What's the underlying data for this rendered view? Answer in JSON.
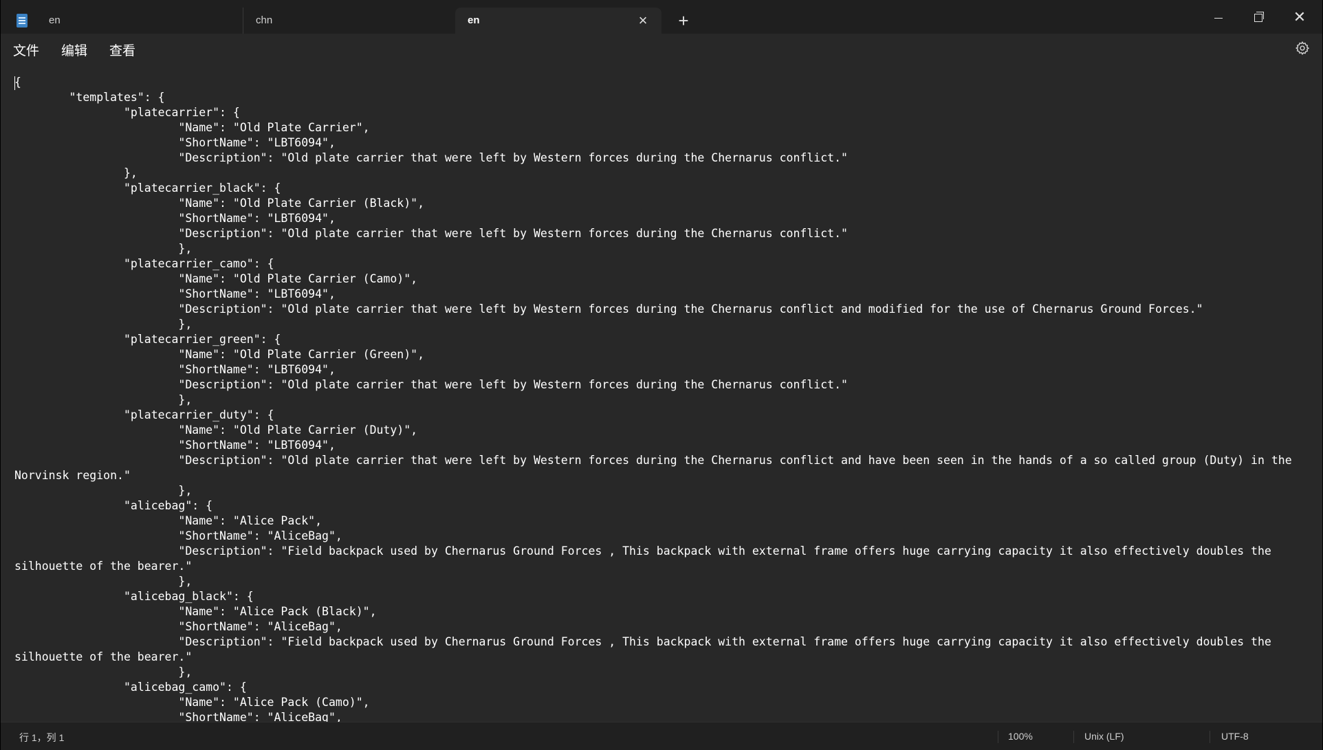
{
  "tabs": [
    {
      "label": "en",
      "active": false
    },
    {
      "label": "chn",
      "active": false
    },
    {
      "label": "en",
      "active": true
    }
  ],
  "icons": {
    "close_tab": "×",
    "new_tab": "+",
    "window_close": "✕"
  },
  "menu": {
    "file": "文件",
    "edit": "编辑",
    "view": "查看"
  },
  "editor": {
    "text": "{\n\t\"templates\": {\n\t\t\"platecarrier\": {\n\t\t\t\"Name\": \"Old Plate Carrier\",\n\t\t\t\"ShortName\": \"LBT6094\",\n\t\t\t\"Description\": \"Old plate carrier that were left by Western forces during the Chernarus conflict.\"\n\t\t},\n\t\t\"platecarrier_black\": {\n\t\t\t\"Name\": \"Old Plate Carrier (Black)\",\n\t\t\t\"ShortName\": \"LBT6094\",\n\t\t\t\"Description\": \"Old plate carrier that were left by Western forces during the Chernarus conflict.\"\n\t\t\t},\n\t\t\"platecarrier_camo\": {\n\t\t\t\"Name\": \"Old Plate Carrier (Camo)\",\n\t\t\t\"ShortName\": \"LBT6094\",\n\t\t\t\"Description\": \"Old plate carrier that were left by Western forces during the Chernarus conflict and modified for the use of Chernarus Ground Forces.\"\n\t\t\t},\n\t\t\"platecarrier_green\": {\n\t\t\t\"Name\": \"Old Plate Carrier (Green)\",\n\t\t\t\"ShortName\": \"LBT6094\",\n\t\t\t\"Description\": \"Old plate carrier that were left by Western forces during the Chernarus conflict.\"\n\t\t\t},\n\t\t\"platecarrier_duty\": {\n\t\t\t\"Name\": \"Old Plate Carrier (Duty)\",\n\t\t\t\"ShortName\": \"LBT6094\",\n\t\t\t\"Description\": \"Old plate carrier that were left by Western forces during the Chernarus conflict and have been seen in the hands of a so called group (Duty) in the Norvinsk region.\"\n\t\t\t},\n\t\t\"alicebag\": {\n\t\t\t\"Name\": \"Alice Pack\",\n\t\t\t\"ShortName\": \"AliceBag\",\n\t\t\t\"Description\": \"Field backpack used by Chernarus Ground Forces , This backpack with external frame offers huge carrying capacity it also effectively doubles the silhouette of the bearer.\"\n\t\t\t},\n\t\t\"alicebag_black\": {\n\t\t\t\"Name\": \"Alice Pack (Black)\",\n\t\t\t\"ShortName\": \"AliceBag\",\n\t\t\t\"Description\": \"Field backpack used by Chernarus Ground Forces , This backpack with external frame offers huge carrying capacity it also effectively doubles the silhouette of the bearer.\"\n\t\t\t},\n\t\t\"alicebag_camo\": {\n\t\t\t\"Name\": \"Alice Pack (Camo)\",\n\t\t\t\"ShortName\": \"AliceBag\","
  },
  "status": {
    "position": "行 1，列 1",
    "zoom": "100%",
    "line_ending": "Unix (LF)",
    "encoding": "UTF-8"
  },
  "colors": {
    "background": "#282828",
    "titlebar": "#1f1f1f",
    "statusbar": "#202020",
    "text": "#ffffff",
    "app_icon": "#3b82c4"
  }
}
